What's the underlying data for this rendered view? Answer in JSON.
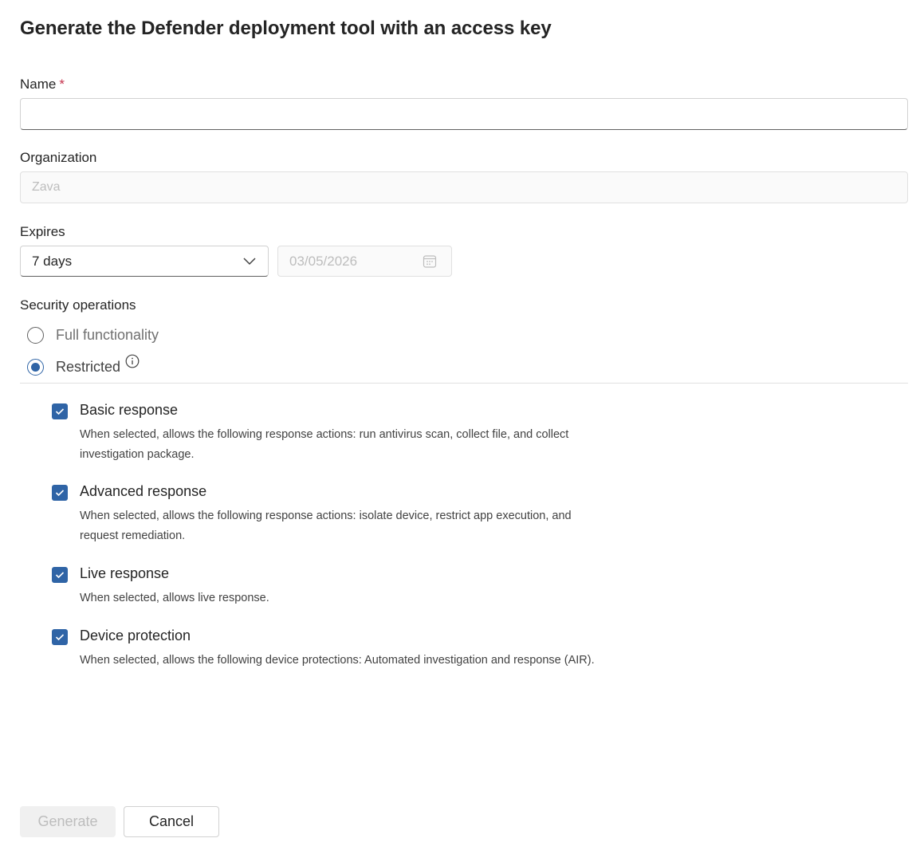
{
  "dialog": {
    "title": "Generate the Defender deployment tool with an access key"
  },
  "name_field": {
    "label": "Name",
    "required_mark": "*",
    "value": ""
  },
  "organization_field": {
    "label": "Organization",
    "placeholder": "Zava"
  },
  "expires": {
    "label": "Expires",
    "selected": "7 days",
    "date": "03/05/2026"
  },
  "security_operations": {
    "label": "Security operations",
    "options": [
      {
        "label": "Full functionality",
        "checked": false
      },
      {
        "label": "Restricted",
        "checked": true,
        "icon": "info-icon"
      }
    ],
    "restrictions": [
      {
        "title": "Basic response",
        "description": "When selected, allows the following response actions: run antivirus scan, collect file, and collect investigation package.",
        "checked": true
      },
      {
        "title": "Advanced response",
        "description": "When selected, allows the following response actions: isolate device, restrict app execution, and request remediation.",
        "checked": true
      },
      {
        "title": "Live response",
        "description": "When selected, allows live response.",
        "checked": true
      },
      {
        "title": "Device protection",
        "description": "When selected, allows the following device protections: Automated investigation and response (AIR).",
        "checked": true
      }
    ]
  },
  "footer": {
    "generate_label": "Generate",
    "cancel_label": "Cancel"
  },
  "colors": {
    "accent": "#2f64a6",
    "required": "#c4314b",
    "disabled_text": "#bdbdbd"
  }
}
